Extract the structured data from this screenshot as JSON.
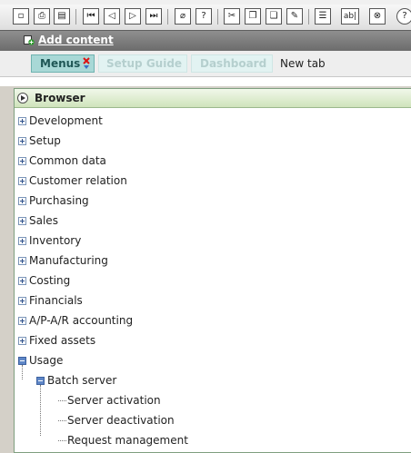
{
  "toolbar": {
    "buttons": [
      {
        "icon": "page-icon",
        "glyph": "▫"
      },
      {
        "icon": "print-icon",
        "glyph": "⎙"
      },
      {
        "icon": "print-preview-icon",
        "glyph": "▤"
      },
      {
        "icon": "first-record-icon",
        "glyph": "⏮"
      },
      {
        "icon": "previous-record-icon",
        "glyph": "◁"
      },
      {
        "icon": "next-record-icon",
        "glyph": "▷"
      },
      {
        "icon": "last-record-icon",
        "glyph": "⏭"
      },
      {
        "icon": "attachment-icon",
        "glyph": "⌀"
      },
      {
        "icon": "help-icon",
        "glyph": "?"
      },
      {
        "icon": "cut-icon",
        "glyph": "✂"
      },
      {
        "icon": "copy-icon",
        "glyph": "❐"
      },
      {
        "icon": "paste-icon",
        "glyph": "❏"
      },
      {
        "icon": "edit-record-icon",
        "glyph": "✎"
      },
      {
        "icon": "list-icon",
        "glyph": "☰"
      },
      {
        "icon": "text-field-icon",
        "glyph": "ab|"
      },
      {
        "icon": "settings-icon",
        "glyph": "⊗"
      },
      {
        "icon": "info-icon",
        "glyph": "?"
      }
    ]
  },
  "band": {
    "add_content_label": "Add content"
  },
  "tabs": {
    "menus": "Menus",
    "setup_guide": "Setup Guide",
    "dashboard": "Dashboard",
    "new_tab": "New tab"
  },
  "browser": {
    "title": "Browser",
    "top_level": [
      "Development",
      "Setup",
      "Common data",
      "Customer relation",
      "Purchasing",
      "Sales",
      "Inventory",
      "Manufacturing",
      "Costing",
      "Financials",
      "A/P-A/R accounting",
      "Fixed assets",
      "Usage"
    ],
    "usage_child": "Batch server",
    "batch_children": [
      "Server activation",
      "Server deactivation",
      "Request management"
    ]
  },
  "colors": {
    "active_tab_bg": "#a8d8d6",
    "active_tab_text": "#1f5756",
    "inactive_tab_text": "#b5cfce",
    "panel_header": "#cfe3bb",
    "band": "#7a7a7a"
  }
}
